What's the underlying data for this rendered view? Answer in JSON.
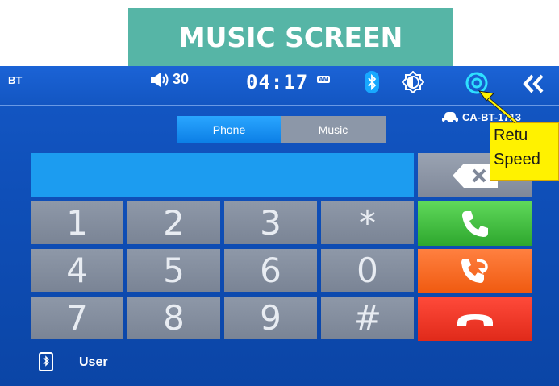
{
  "banner": {
    "title": "MUSIC SCREEN"
  },
  "status_bar": {
    "bt_label": "BT",
    "volume": "30",
    "time": "04:17",
    "am_pm": "AM",
    "device_name": "CA-BT-1713"
  },
  "tabs": [
    {
      "label": "Phone",
      "active": true
    },
    {
      "label": "Music",
      "active": false
    }
  ],
  "keypad": [
    "1",
    "2",
    "3",
    "*",
    "4",
    "5",
    "6",
    "0",
    "7",
    "8",
    "9",
    "#"
  ],
  "footer": {
    "user_label": "User"
  },
  "callout": {
    "line1": "Retu",
    "line2": "Speed"
  },
  "colors": {
    "banner": "#56b5a6",
    "screen_bg": "#1458c6",
    "call": "#2ea72e",
    "redial": "#f05a10",
    "hangup": "#e02a1a",
    "callout": "#fff200"
  },
  "icons": [
    "volume-icon",
    "bluetooth-icon",
    "brightness-icon",
    "return-icon",
    "collapse-icon",
    "car-icon",
    "backspace-icon",
    "phone-call-icon",
    "redial-icon",
    "hangup-icon",
    "phone-device-icon"
  ]
}
